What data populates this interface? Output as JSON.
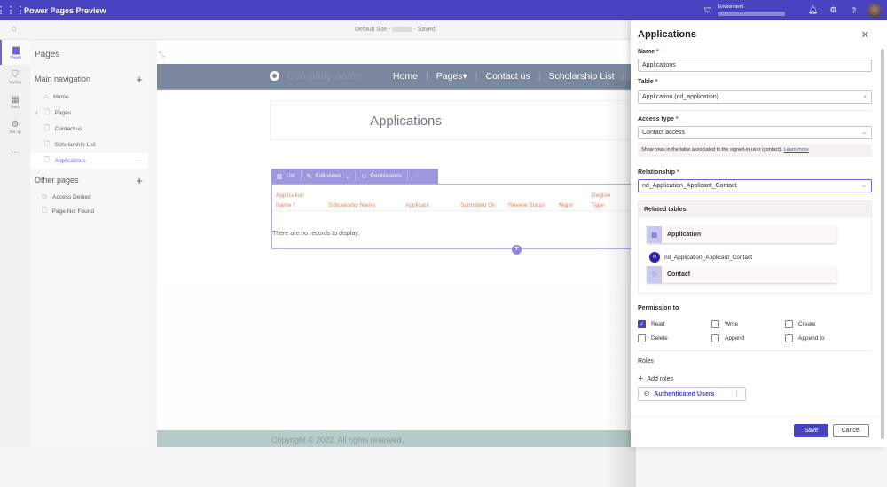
{
  "topbar": {
    "app_title": "Power Pages Preview",
    "environment_label": "Environment",
    "icons": [
      "waffle-icon",
      "environment-icon",
      "bell-icon",
      "settings-icon",
      "help-icon",
      "avatar"
    ]
  },
  "subbar": {
    "site_name": "Default Site - ",
    "saved": " - Saved"
  },
  "rail": {
    "items": [
      {
        "label": "Pages",
        "icon": "page-icon",
        "active": true
      },
      {
        "label": "Styling",
        "icon": "brush-icon"
      },
      {
        "label": "Data",
        "icon": "table-icon"
      },
      {
        "label": "Set up",
        "icon": "setup-icon"
      },
      {
        "label": "···",
        "icon": "more-icon"
      }
    ]
  },
  "pages_panel": {
    "title": "Pages",
    "main_nav_title": "Main navigation",
    "main_nav": [
      {
        "label": "Home",
        "icon": "home-icon"
      },
      {
        "label": "Pages",
        "icon": "page-icon",
        "expandable": true
      },
      {
        "label": "Contact us",
        "icon": "page-icon"
      },
      {
        "label": "Scholarship List",
        "icon": "page-icon"
      },
      {
        "label": "Applications",
        "icon": "page-icon",
        "selected": true
      }
    ],
    "other_title": "Other pages",
    "other_pages": [
      {
        "label": "Access Denied",
        "icon": "person-lock-icon"
      },
      {
        "label": "Page Not Found",
        "icon": "page-search-icon"
      }
    ]
  },
  "site": {
    "company_name": "Company name",
    "nav": [
      "Home",
      "Pages▾",
      "Contact us",
      "Scholarship List"
    ],
    "page_title": "Applications",
    "list_toolbar": {
      "list": "List",
      "edit_views": "Edit views",
      "permissions": "Permissions",
      "more": "···"
    },
    "columns": [
      {
        "line1": "Application",
        "line2": "Name 🠕"
      },
      {
        "line1": "",
        "line2": "Scholarship Name"
      },
      {
        "line1": "",
        "line2": "Applicant"
      },
      {
        "line1": "",
        "line2": "Submitted On"
      },
      {
        "line1": "",
        "line2": "Review Status"
      },
      {
        "line1": "",
        "line2": "Major"
      },
      {
        "line1": "Degree",
        "line2": "Type"
      }
    ],
    "empty_message": "There are no records to display.",
    "footer": "Copyright © 2022. All rights reserved."
  },
  "panel": {
    "title": "Applications",
    "name_label": "Name",
    "name_value": "Applications",
    "table_label": "Table",
    "table_value": "Application (nd_application)",
    "access_label": "Access type",
    "access_value": "Contact access",
    "access_info": "Show rows in the table associated to the signed-in user (contact).",
    "learn_more": "Learn more",
    "relationship_label": "Relationship",
    "relationship_value": "nd_Application_Applicant_Contact",
    "related_tables_title": "Related tables",
    "related_from": "Application",
    "related_link": "nd_Application_Applicant_Contact",
    "related_to": "Contact",
    "permission_label": "Permission to",
    "permissions": [
      {
        "label": "Read",
        "checked": true
      },
      {
        "label": "Write",
        "checked": false
      },
      {
        "label": "Create",
        "checked": false
      },
      {
        "label": "Delete",
        "checked": false
      },
      {
        "label": "Append",
        "checked": false
      },
      {
        "label": "Append to",
        "checked": false
      }
    ],
    "roles_label": "Roles",
    "add_roles": "Add roles",
    "role_chip": "Authenticated Users",
    "save": "Save",
    "cancel": "Cancel",
    "required_mark": "*"
  }
}
